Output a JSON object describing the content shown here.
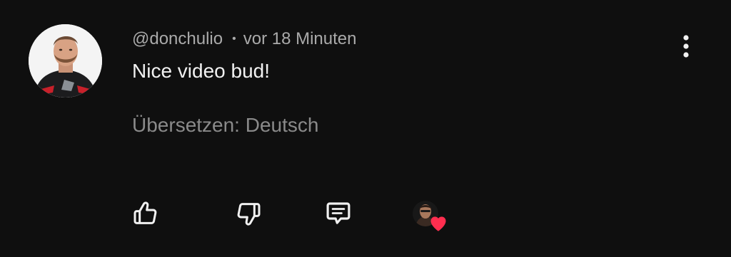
{
  "comment": {
    "author": "@donchulio",
    "separator": "•",
    "time": "vor 18 Minuten",
    "text": "Nice video bud!",
    "translate_label": "Übersetzen: Deutsch"
  },
  "icons": {
    "more": "more-vertical-icon",
    "like": "thumbs-up-icon",
    "dislike": "thumbs-down-icon",
    "reply": "comment-reply-icon",
    "creator_heart": "creator-heart-icon"
  },
  "colors": {
    "background": "#0f0f0f",
    "primary_text": "#f1f1f1",
    "secondary_text": "#aaaaaa",
    "heart": "#ff2e4f"
  }
}
